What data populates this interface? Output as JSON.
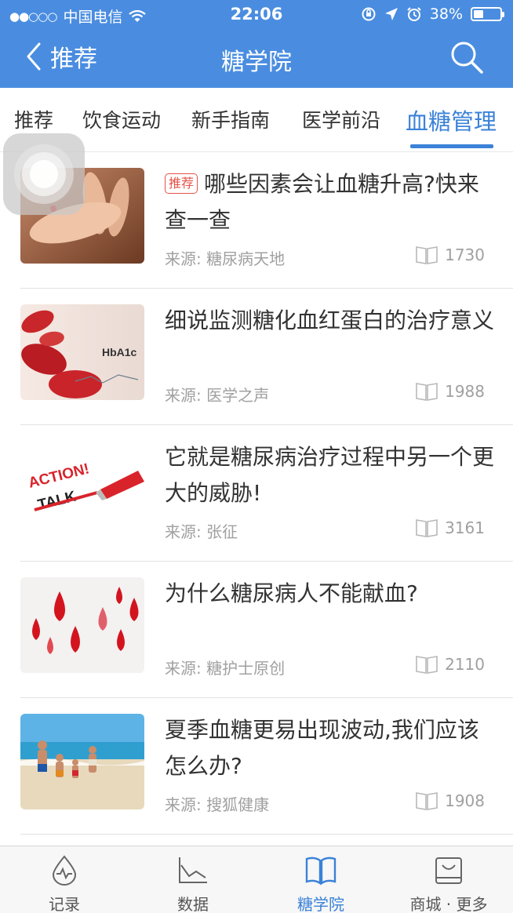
{
  "status_bar": {
    "signal": "●●○○○",
    "carrier": "中国电信",
    "time": "22:06",
    "battery_percent": "38%",
    "battery_level": 0.38
  },
  "nav": {
    "back_label": "推荐",
    "title": "糖学院"
  },
  "tabs": [
    {
      "label": "推荐",
      "active": false
    },
    {
      "label": "饮食运动",
      "active": false
    },
    {
      "label": "新手指南",
      "active": false
    },
    {
      "label": "医学前沿",
      "active": false
    },
    {
      "label": "血糖管理",
      "active": true
    }
  ],
  "articles": [
    {
      "tag": "推荐",
      "title": "哪些因素会让血糖升高?快来查一查",
      "source": "来源: 糖尿病天地",
      "reads": "1730",
      "thumb_icon": "finger-blood-drop-photo"
    },
    {
      "tag": "",
      "title": "细说监测糖化血红蛋白的治疗意义",
      "source": "来源: 医学之声",
      "reads": "1988",
      "thumb_icon": "red-blood-cells-hba1c-photo",
      "thumb_text": "HbA1c"
    },
    {
      "tag": "",
      "title": "它就是糖尿病治疗过程中另一个更大的威胁!",
      "source": "来源: 张征",
      "reads": "3161",
      "thumb_icon": "action-talk-marker-photo",
      "thumb_text_1": "ACTION!",
      "thumb_text_2": "TALK"
    },
    {
      "tag": "",
      "title": "为什么糖尿病人不能献血?",
      "source": "来源: 糖护士原创",
      "reads": "2110",
      "thumb_icon": "blood-drops-photo"
    },
    {
      "tag": "",
      "title": "夏季血糖更易出现波动,我们应该怎么办?",
      "source": "来源: 搜狐健康",
      "reads": "1908",
      "thumb_icon": "family-beach-photo"
    }
  ],
  "tabbar": [
    {
      "label": "记录",
      "icon": "drop-pulse-icon",
      "active": false
    },
    {
      "label": "数据",
      "icon": "line-chart-icon",
      "active": false
    },
    {
      "label": "糖学院",
      "icon": "book-icon",
      "active": true
    },
    {
      "label": "商城 · 更多",
      "icon": "shopping-bag-icon",
      "active": false
    }
  ],
  "colors": {
    "primary": "#4a8de0",
    "accent": "#3b82d8",
    "tag_red": "#e5524a"
  }
}
